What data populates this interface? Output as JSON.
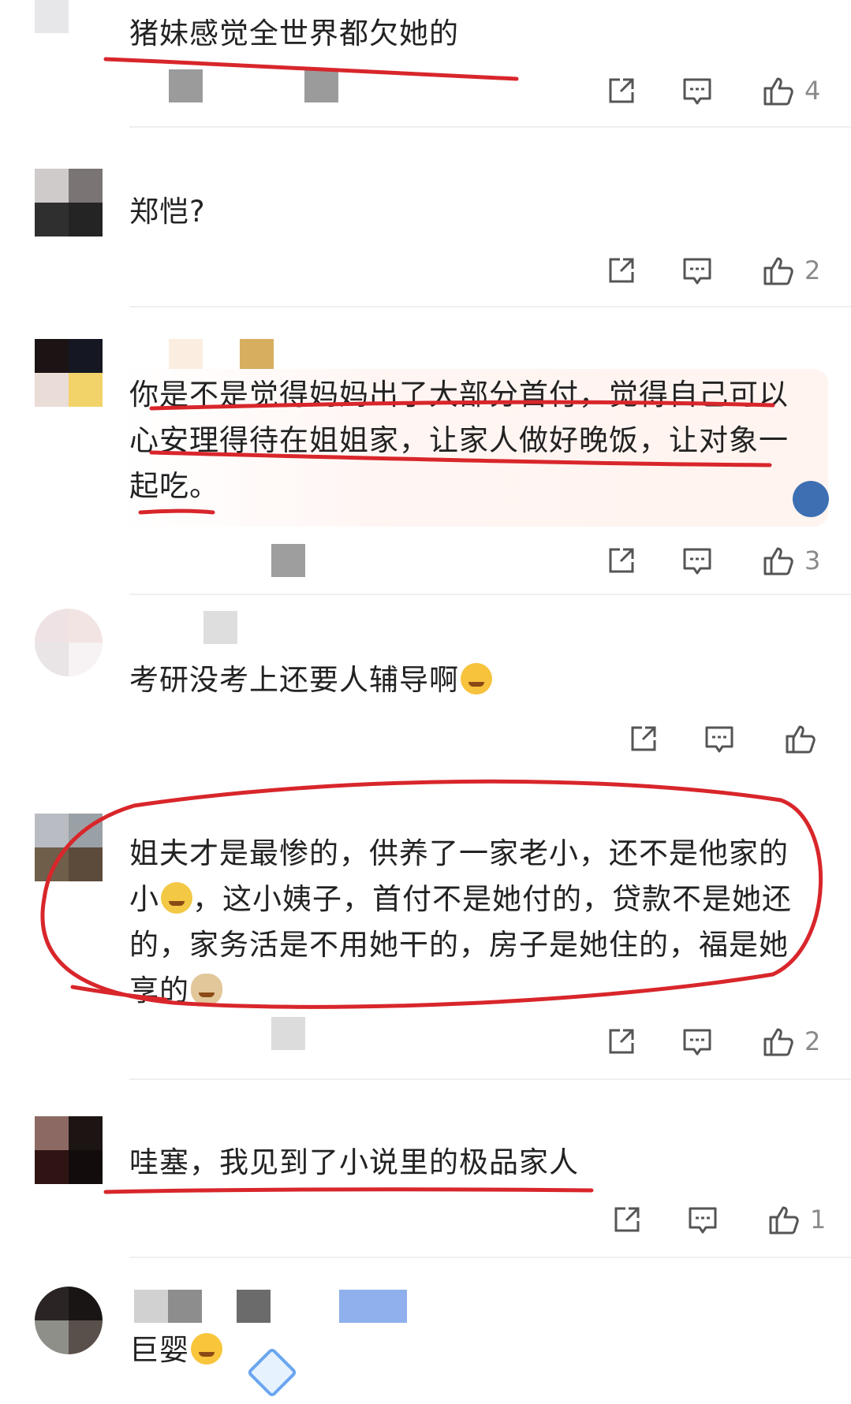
{
  "comments": [
    {
      "text": "猪妹感觉全世界都欠她的",
      "likes": "4"
    },
    {
      "text": "郑恺?",
      "likes": "2"
    },
    {
      "text": "你是不是觉得妈妈出了大部分首付，觉得自己可以心安理得待在姐姐家，让家人做好晚饭，让对象一起吃。",
      "likes": "3"
    },
    {
      "text": "考研没考上还要人辅导啊",
      "likes": ""
    },
    {
      "text_a": "姐夫才是最惨的，供养了一家老小，还不是他家的小",
      "text_b": "，这小姨子，首付不是她付的，贷款不是她还的，家务活是不用她干的，房子是她住的，福是她享的",
      "likes": "2"
    },
    {
      "text": "哇塞，我见到了小说里的极品家人",
      "likes": "1"
    },
    {
      "text": "巨婴",
      "likes": ""
    }
  ],
  "icons": {
    "share": "share-icon",
    "reply": "comment-icon",
    "like": "thumbs-up-icon"
  },
  "colors": {
    "annotation": "#d8262b",
    "count": "#8a8a8a",
    "text": "#222222"
  }
}
